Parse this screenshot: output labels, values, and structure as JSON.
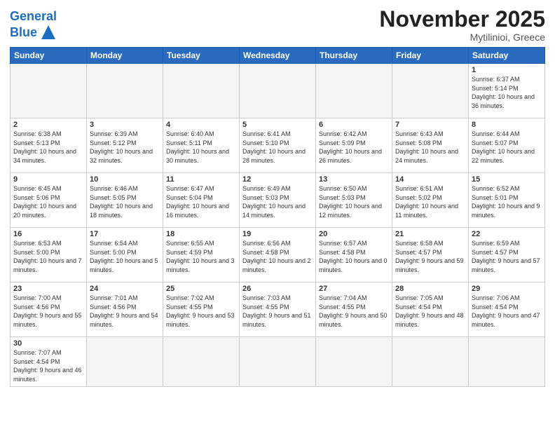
{
  "header": {
    "logo_general": "General",
    "logo_blue": "Blue",
    "month_title": "November 2025",
    "location": "Mytilinioi, Greece"
  },
  "days_of_week": [
    "Sunday",
    "Monday",
    "Tuesday",
    "Wednesday",
    "Thursday",
    "Friday",
    "Saturday"
  ],
  "weeks": [
    [
      {
        "day": "",
        "info": ""
      },
      {
        "day": "",
        "info": ""
      },
      {
        "day": "",
        "info": ""
      },
      {
        "day": "",
        "info": ""
      },
      {
        "day": "",
        "info": ""
      },
      {
        "day": "",
        "info": ""
      },
      {
        "day": "1",
        "info": "Sunrise: 6:37 AM\nSunset: 5:14 PM\nDaylight: 10 hours and 36 minutes."
      }
    ],
    [
      {
        "day": "2",
        "info": "Sunrise: 6:38 AM\nSunset: 5:13 PM\nDaylight: 10 hours and 34 minutes."
      },
      {
        "day": "3",
        "info": "Sunrise: 6:39 AM\nSunset: 5:12 PM\nDaylight: 10 hours and 32 minutes."
      },
      {
        "day": "4",
        "info": "Sunrise: 6:40 AM\nSunset: 5:11 PM\nDaylight: 10 hours and 30 minutes."
      },
      {
        "day": "5",
        "info": "Sunrise: 6:41 AM\nSunset: 5:10 PM\nDaylight: 10 hours and 28 minutes."
      },
      {
        "day": "6",
        "info": "Sunrise: 6:42 AM\nSunset: 5:09 PM\nDaylight: 10 hours and 26 minutes."
      },
      {
        "day": "7",
        "info": "Sunrise: 6:43 AM\nSunset: 5:08 PM\nDaylight: 10 hours and 24 minutes."
      },
      {
        "day": "8",
        "info": "Sunrise: 6:44 AM\nSunset: 5:07 PM\nDaylight: 10 hours and 22 minutes."
      }
    ],
    [
      {
        "day": "9",
        "info": "Sunrise: 6:45 AM\nSunset: 5:06 PM\nDaylight: 10 hours and 20 minutes."
      },
      {
        "day": "10",
        "info": "Sunrise: 6:46 AM\nSunset: 5:05 PM\nDaylight: 10 hours and 18 minutes."
      },
      {
        "day": "11",
        "info": "Sunrise: 6:47 AM\nSunset: 5:04 PM\nDaylight: 10 hours and 16 minutes."
      },
      {
        "day": "12",
        "info": "Sunrise: 6:49 AM\nSunset: 5:03 PM\nDaylight: 10 hours and 14 minutes."
      },
      {
        "day": "13",
        "info": "Sunrise: 6:50 AM\nSunset: 5:03 PM\nDaylight: 10 hours and 12 minutes."
      },
      {
        "day": "14",
        "info": "Sunrise: 6:51 AM\nSunset: 5:02 PM\nDaylight: 10 hours and 11 minutes."
      },
      {
        "day": "15",
        "info": "Sunrise: 6:52 AM\nSunset: 5:01 PM\nDaylight: 10 hours and 9 minutes."
      }
    ],
    [
      {
        "day": "16",
        "info": "Sunrise: 6:53 AM\nSunset: 5:00 PM\nDaylight: 10 hours and 7 minutes."
      },
      {
        "day": "17",
        "info": "Sunrise: 6:54 AM\nSunset: 5:00 PM\nDaylight: 10 hours and 5 minutes."
      },
      {
        "day": "18",
        "info": "Sunrise: 6:55 AM\nSunset: 4:59 PM\nDaylight: 10 hours and 3 minutes."
      },
      {
        "day": "19",
        "info": "Sunrise: 6:56 AM\nSunset: 4:58 PM\nDaylight: 10 hours and 2 minutes."
      },
      {
        "day": "20",
        "info": "Sunrise: 6:57 AM\nSunset: 4:58 PM\nDaylight: 10 hours and 0 minutes."
      },
      {
        "day": "21",
        "info": "Sunrise: 6:58 AM\nSunset: 4:57 PM\nDaylight: 9 hours and 59 minutes."
      },
      {
        "day": "22",
        "info": "Sunrise: 6:59 AM\nSunset: 4:57 PM\nDaylight: 9 hours and 57 minutes."
      }
    ],
    [
      {
        "day": "23",
        "info": "Sunrise: 7:00 AM\nSunset: 4:56 PM\nDaylight: 9 hours and 55 minutes."
      },
      {
        "day": "24",
        "info": "Sunrise: 7:01 AM\nSunset: 4:56 PM\nDaylight: 9 hours and 54 minutes."
      },
      {
        "day": "25",
        "info": "Sunrise: 7:02 AM\nSunset: 4:55 PM\nDaylight: 9 hours and 53 minutes."
      },
      {
        "day": "26",
        "info": "Sunrise: 7:03 AM\nSunset: 4:55 PM\nDaylight: 9 hours and 51 minutes."
      },
      {
        "day": "27",
        "info": "Sunrise: 7:04 AM\nSunset: 4:55 PM\nDaylight: 9 hours and 50 minutes."
      },
      {
        "day": "28",
        "info": "Sunrise: 7:05 AM\nSunset: 4:54 PM\nDaylight: 9 hours and 48 minutes."
      },
      {
        "day": "29",
        "info": "Sunrise: 7:06 AM\nSunset: 4:54 PM\nDaylight: 9 hours and 47 minutes."
      }
    ],
    [
      {
        "day": "30",
        "info": "Sunrise: 7:07 AM\nSunset: 4:54 PM\nDaylight: 9 hours and 46 minutes."
      },
      {
        "day": "",
        "info": ""
      },
      {
        "day": "",
        "info": ""
      },
      {
        "day": "",
        "info": ""
      },
      {
        "day": "",
        "info": ""
      },
      {
        "day": "",
        "info": ""
      },
      {
        "day": "",
        "info": ""
      }
    ]
  ]
}
